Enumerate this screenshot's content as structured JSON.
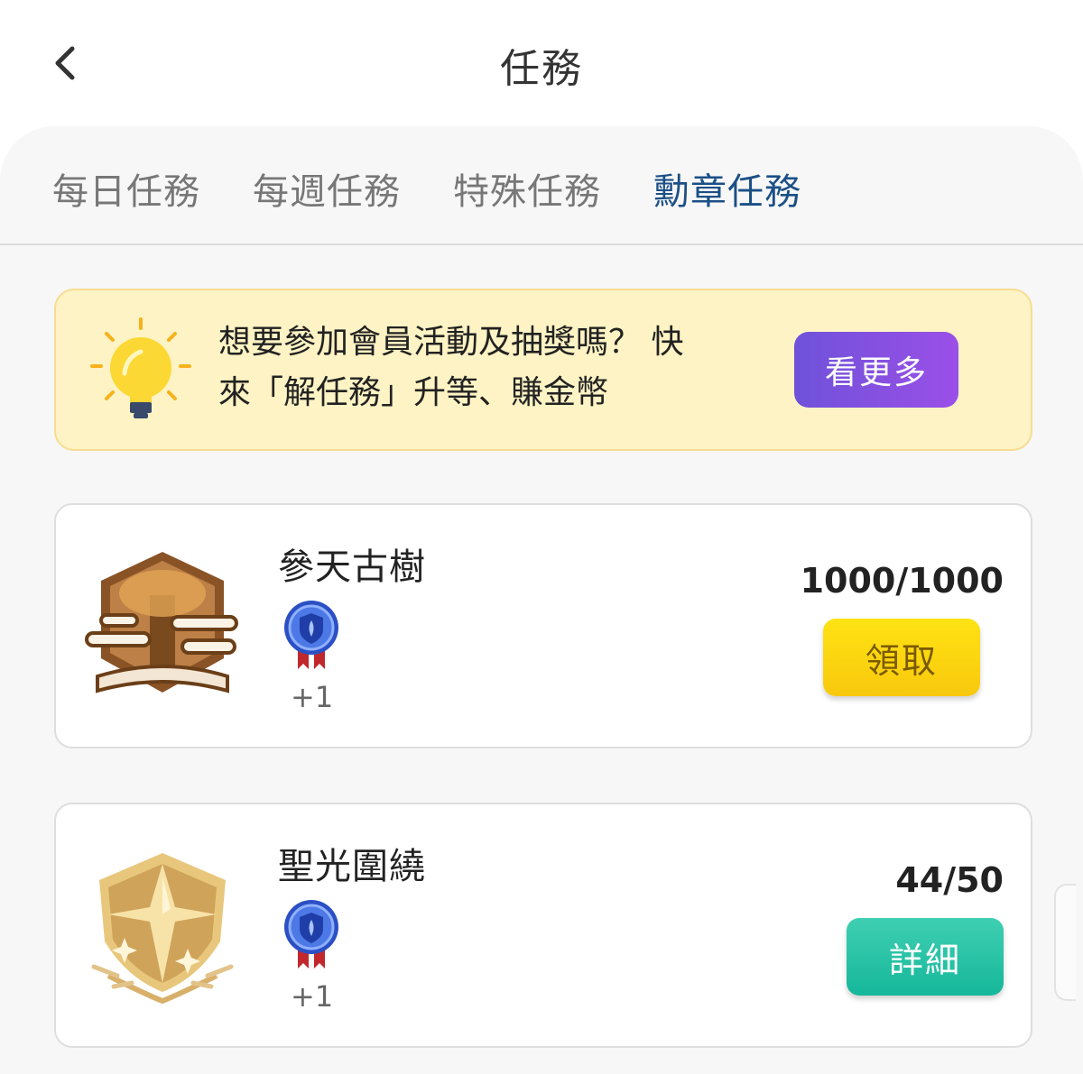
{
  "header": {
    "title": "任務",
    "back_icon": "chevron-left-icon"
  },
  "tabs": [
    {
      "label": "每日任務",
      "active": false
    },
    {
      "label": "每週任務",
      "active": false
    },
    {
      "label": "特殊任務",
      "active": false
    },
    {
      "label": "勳章任務",
      "active": true
    }
  ],
  "banner": {
    "icon": "lightbulb-icon",
    "text_line1": "想要參加會員活動及抽獎嗎？ 快",
    "text_line2": "來「解任務」升等、賺金幣",
    "button_label": "看更多"
  },
  "missions": [
    {
      "title": "參天古樹",
      "medal_icon": "ancient-tree-medal-icon",
      "reward_icon": "blue-badge-medal-icon",
      "reward_count": "+1",
      "progress": "1000/1000",
      "button_label": "領取",
      "button_type": "claim"
    },
    {
      "title": "聖光圍繞",
      "medal_icon": "holy-light-medal-icon",
      "reward_icon": "blue-badge-medal-icon",
      "reward_count": "+1",
      "progress": "44/50",
      "button_label": "詳細",
      "button_type": "detail"
    }
  ],
  "colors": {
    "active_tab": "#1b4f86",
    "banner_bg": "#fdf3c4",
    "more_button": "#7b50e0",
    "claim_button": "#f8d20f",
    "detail_button": "#24c1a5"
  }
}
